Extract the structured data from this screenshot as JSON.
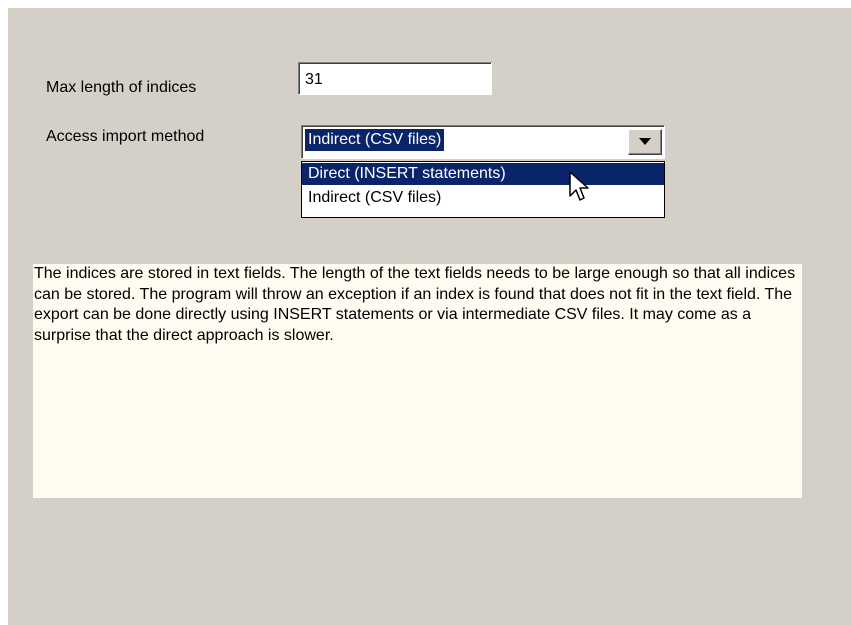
{
  "form": {
    "max_length": {
      "label": "Max length of indices",
      "value": "31"
    },
    "access_import": {
      "label": "Access import method",
      "selected_value": "Indirect (CSV files)",
      "options": [
        {
          "label": "Direct (INSERT statements)",
          "highlighted": true
        },
        {
          "label": "Indirect (CSV files)",
          "highlighted": false
        }
      ]
    }
  },
  "help": {
    "text": "The indices are stored in text fields. The length of the text fields needs to be large enough so that all indices can be stored. The program will throw an exception if an index is found that does not fit in the text field. The export can be done directly using INSERT statements or via intermediate CSV files. It may come as a surprise that the direct approach is slower."
  },
  "colors": {
    "panel_background": "#d4d0c8",
    "selection_highlight": "#0a246a",
    "help_background": "#fffbf0"
  },
  "icons": {
    "combo_arrow": "chevron-down-icon",
    "cursor": "mouse-pointer-icon"
  }
}
